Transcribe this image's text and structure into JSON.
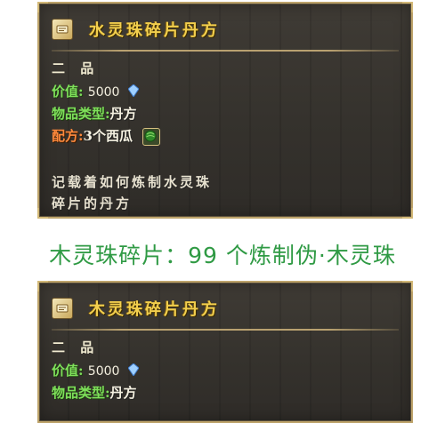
{
  "top_card": {
    "title": "水灵珠碎片丹方",
    "grade": "二 品",
    "value_label": "价值:",
    "value": "5000",
    "type_label": "物品类型:",
    "type_value": "丹方",
    "recipe_label": "配方:",
    "recipe_value": "3个西瓜",
    "desc_line1": "记载着如何炼制水灵珠",
    "desc_line2": "碎片的丹方"
  },
  "caption": "木灵珠碎片：99 个炼制伪·木灵珠",
  "bottom_card": {
    "title": "木灵珠碎片丹方",
    "grade": "二 品",
    "value_label": "价值:",
    "value": "5000",
    "type_label": "物品类型:",
    "type_value": "丹方"
  },
  "icons": {
    "title_icon": "scroll-icon",
    "value_icon": "crystal-icon",
    "recipe_icon": "watermelon-icon"
  },
  "colors": {
    "title": "#f2cf4e",
    "label_green": "#7ee05a",
    "recipe_orange": "#ff8a3d",
    "caption_green": "#2f9a44"
  }
}
